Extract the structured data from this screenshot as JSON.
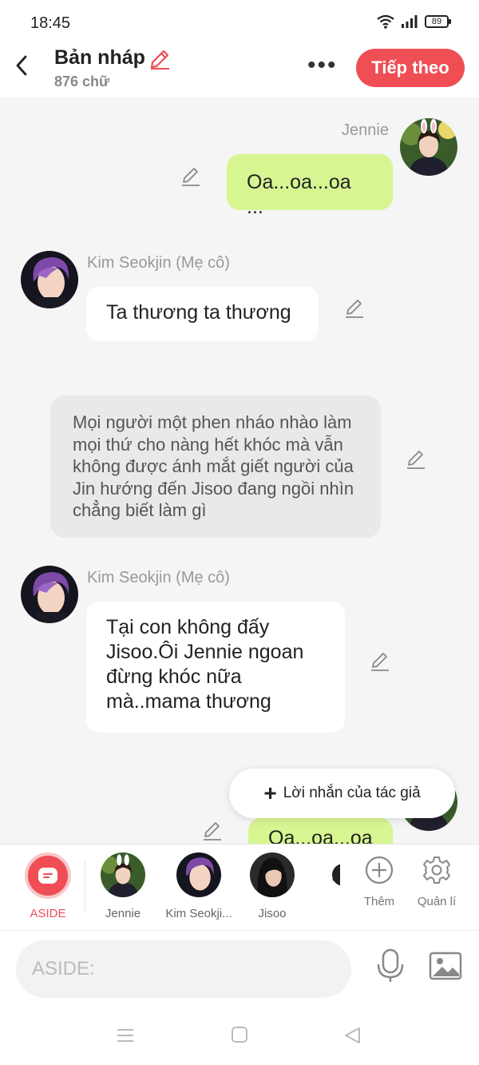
{
  "status_bar": {
    "time": "18:45",
    "battery": "89"
  },
  "header": {
    "title": "Bản nháp",
    "word_count": "876 chữ",
    "next_label": "Tiếp theo"
  },
  "messages": [
    {
      "speaker": "Jennie",
      "text": "Oa...oa...oa ..."
    },
    {
      "speaker": "Kim Seokjin (Mẹ cô)",
      "text": "Ta thương ta thương"
    },
    {
      "narration": "Mọi người một phen nháo nhào làm mọi thứ cho nàng hết khóc mà vẫn không được  ánh mắt giết người của Jin hướng đến Jisoo đang ngồi nhìn chẳng biết  làm gì"
    },
    {
      "speaker": "Kim Seokjin (Mẹ cô)",
      "text": "Tại con không đấy Jisoo.Ôi Jennie ngoan đừng khóc nữa mà..mama thương"
    },
    {
      "text": "Oa...oa...oa"
    }
  ],
  "author_note_label": "Lời nhắn của tác giả",
  "character_bar": {
    "aside_label": "ASIDE",
    "characters": [
      "Jennie",
      "Kim Seokji...",
      "Jisoo"
    ],
    "add_label": "Thêm",
    "manage_label": "Quản lí"
  },
  "input": {
    "placeholder": "ASIDE:"
  },
  "colors": {
    "accent": "#ef4e55",
    "green_bubble": "#d7f692",
    "narration_bg": "#e9e9e9"
  },
  "icons": [
    "back-arrow-icon",
    "pencil-icon",
    "more-icon",
    "plus-icon",
    "gear-icon",
    "mic-icon",
    "image-icon",
    "menu-icon",
    "home-icon",
    "back-triangle-icon"
  ]
}
